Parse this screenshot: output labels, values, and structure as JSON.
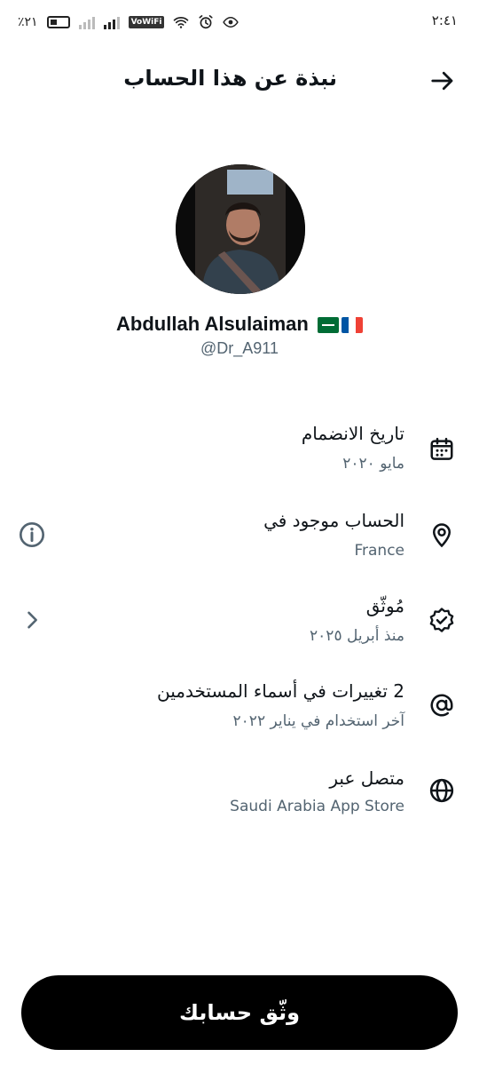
{
  "status_bar": {
    "time": "٢:٤١",
    "battery": "٪٢١",
    "network_badge": "VoWiFi"
  },
  "header": {
    "title": "نبذة عن هذا الحساب",
    "back_icon": "arrow-right-icon"
  },
  "profile": {
    "display_name": "Abdullah Alsulaiman",
    "flags": [
      "saudi-arabia-flag",
      "france-flag"
    ],
    "handle": "@Dr_A911"
  },
  "rows": [
    {
      "icon": "calendar-icon",
      "title": "تاريخ الانضمام",
      "subtitle": "مايو ٢٠٢٠"
    },
    {
      "icon": "location-pin-icon",
      "title": "الحساب موجود في",
      "subtitle": "France",
      "action_icon": "info-icon"
    },
    {
      "icon": "verified-badge-icon",
      "title": "مُوثّق",
      "subtitle": "منذ أبريل ٢٠٢٥",
      "action_icon": "chevron-right-icon"
    },
    {
      "icon": "at-sign-icon",
      "title": "2 تغييرات في أسماء المستخدمين",
      "subtitle": "آخر استخدام في يناير ٢٠٢٢"
    },
    {
      "icon": "globe-icon",
      "title": "متصل عبر",
      "subtitle": "Saudi Arabia App Store"
    }
  ],
  "verify_button": {
    "label": "وثّق حسابك"
  },
  "colors": {
    "text_primary": "#0f1419",
    "text_secondary": "#536471",
    "button_bg": "#000000"
  }
}
